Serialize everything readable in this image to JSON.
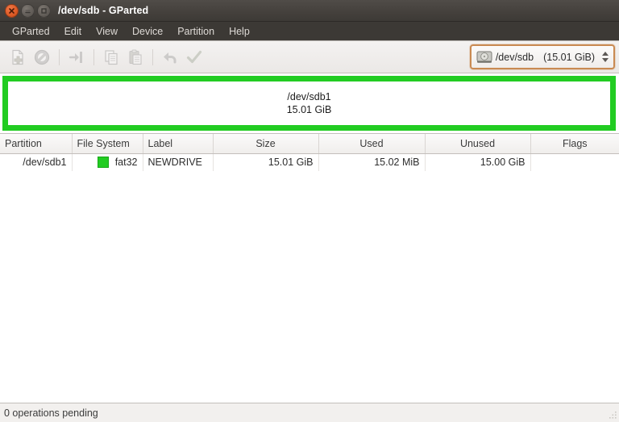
{
  "window": {
    "title": "/dev/sdb - GParted",
    "buttons": [
      {
        "name": "close",
        "label": "Close"
      },
      {
        "name": "minimize",
        "label": "Minimize"
      },
      {
        "name": "maximize",
        "label": "Maximize"
      }
    ]
  },
  "menubar": {
    "items": [
      {
        "label": "GParted"
      },
      {
        "label": "Edit"
      },
      {
        "label": "View"
      },
      {
        "label": "Device"
      },
      {
        "label": "Partition"
      },
      {
        "label": "Help"
      }
    ]
  },
  "toolbar": {
    "buttons": [
      {
        "icon": "new-partition-icon",
        "label": "New",
        "enabled": false
      },
      {
        "icon": "delete-partition-icon",
        "label": "Delete",
        "enabled": false
      },
      {
        "icon": "resize-move-icon",
        "label": "Resize/Move",
        "enabled": false
      },
      {
        "icon": "copy-icon",
        "label": "Copy",
        "enabled": false
      },
      {
        "icon": "paste-icon",
        "label": "Paste",
        "enabled": false
      },
      {
        "icon": "undo-icon",
        "label": "Undo All Operations",
        "enabled": false
      },
      {
        "icon": "apply-icon",
        "label": "Apply All Operations",
        "enabled": false
      }
    ],
    "device_selector": {
      "icon": "hard-disk-icon",
      "device": "/dev/sdb",
      "size": "(15.01 GiB)",
      "accent_color": "#c98a52"
    }
  },
  "graphic": {
    "partition_name": "/dev/sdb1",
    "partition_size": "15.01 GiB",
    "border_color": "#22cc22",
    "fill_color": "#ffffff"
  },
  "table": {
    "headers": [
      {
        "label": "Partition",
        "align": "left"
      },
      {
        "label": "File System",
        "align": "left"
      },
      {
        "label": "Label",
        "align": "left"
      },
      {
        "label": "Size",
        "align": "center"
      },
      {
        "label": "Used",
        "align": "center"
      },
      {
        "label": "Unused",
        "align": "center"
      },
      {
        "label": "Flags",
        "align": "center"
      }
    ],
    "rows": [
      {
        "partition": "/dev/sdb1",
        "filesystem": "fat32",
        "filesystem_color": "#22cc22",
        "label": "NEWDRIVE",
        "size": "15.01 GiB",
        "used": "15.02 MiB",
        "unused": "15.00 GiB",
        "flags": ""
      }
    ]
  },
  "statusbar": {
    "text": "0 operations pending"
  }
}
